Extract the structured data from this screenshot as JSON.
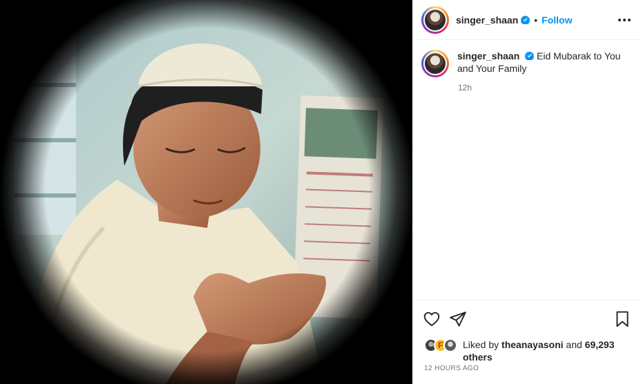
{
  "post": {
    "username": "singer_shaan",
    "verified": true,
    "follow_label": "Follow",
    "separator": "•",
    "caption_text": "Eid Mubarak to You and Your Family",
    "caption_time": "12h",
    "liked_by_prefix": "Liked by",
    "liked_by_user": "theanayasoni",
    "liked_by_and": "and",
    "liked_by_count": "69,293",
    "liked_by_others": "others",
    "timestamp": "12 HOURS AGO"
  },
  "icons": {
    "more": "more-options-icon",
    "verified": "verified-badge-icon",
    "like": "heart-icon",
    "share": "paper-plane-icon",
    "save": "bookmark-icon"
  },
  "colors": {
    "accent": "#0095f6",
    "verified": "#0095f6",
    "text": "#262626",
    "muted": "#737373"
  }
}
